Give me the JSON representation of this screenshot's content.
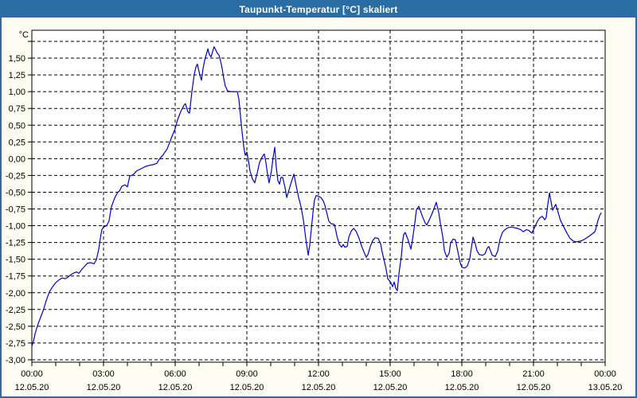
{
  "window": {
    "title": "Taupunkt-Temperatur [°C] skaliert",
    "title_bar_color": "#2a6da4",
    "frame_color": "#2a6da4",
    "background_color": "#fcfcf0",
    "plot_background_color": "#ffffff"
  },
  "chart_data": {
    "type": "line",
    "title": "Taupunkt-Temperatur [°C] skaliert",
    "xlabel": "",
    "ylabel": "°C",
    "ylim": [
      -3.05,
      1.92
    ],
    "xlim_hours": [
      0,
      24
    ],
    "grid": "dashed-black",
    "legend": "none",
    "line_color": "#0000cc",
    "axis_color": "#000000",
    "text_color": "#000000",
    "y_axis": {
      "unit": "°C",
      "gridline_step": 0.25,
      "top_gridline_value": 1.75,
      "bottom_gridline_value": -3.0,
      "ticks": [
        {
          "value": 1.5,
          "label": "1,50"
        },
        {
          "value": 1.25,
          "label": "1,25"
        },
        {
          "value": 1.0,
          "label": "1,00"
        },
        {
          "value": 0.75,
          "label": "0,75"
        },
        {
          "value": 0.5,
          "label": "0,50"
        },
        {
          "value": 0.25,
          "label": "0,25"
        },
        {
          "value": 0.0,
          "label": "0,00"
        },
        {
          "value": -0.25,
          "label": "-0,25"
        },
        {
          "value": -0.5,
          "label": "-0,50"
        },
        {
          "value": -0.75,
          "label": "-0,75"
        },
        {
          "value": -1.0,
          "label": "-1,00"
        },
        {
          "value": -1.25,
          "label": "-1,25"
        },
        {
          "value": -1.5,
          "label": "-1,50"
        },
        {
          "value": -1.75,
          "label": "-1,75"
        },
        {
          "value": -2.0,
          "label": "-2,00"
        },
        {
          "value": -2.25,
          "label": "-2,25"
        },
        {
          "value": -2.5,
          "label": "-2,50"
        },
        {
          "value": -2.75,
          "label": "-2,75"
        },
        {
          "value": -3.0,
          "label": "-3,00"
        }
      ]
    },
    "x_axis": {
      "minor_tick_every_hours": 1,
      "major_ticks": [
        {
          "hour": 0,
          "time": "00:00",
          "date": "12.05.20"
        },
        {
          "hour": 3,
          "time": "03:00",
          "date": "12.05.20"
        },
        {
          "hour": 6,
          "time": "06:00",
          "date": "12.05.20"
        },
        {
          "hour": 9,
          "time": "09:00",
          "date": "12.05.20"
        },
        {
          "hour": 12,
          "time": "12:00",
          "date": "12.05.20"
        },
        {
          "hour": 15,
          "time": "15:00",
          "date": "12.05.20"
        },
        {
          "hour": 18,
          "time": "18:00",
          "date": "12.05.20"
        },
        {
          "hour": 21,
          "time": "21:00",
          "date": "12.05.20"
        },
        {
          "hour": 24,
          "time": "00:00",
          "date": "13.05.20"
        }
      ]
    },
    "series": [
      {
        "name": "Taupunkt-Temperatur",
        "points": [
          [
            0,
            -2.8
          ],
          [
            0.07,
            -2.72
          ],
          [
            0.13,
            -2.62
          ],
          [
            0.2,
            -2.53
          ],
          [
            0.33,
            -2.4
          ],
          [
            0.47,
            -2.27
          ],
          [
            0.6,
            -2.12
          ],
          [
            0.73,
            -1.99
          ],
          [
            0.87,
            -1.91
          ],
          [
            1,
            -1.85
          ],
          [
            1.13,
            -1.81
          ],
          [
            1.27,
            -1.78
          ],
          [
            1.4,
            -1.79
          ],
          [
            1.5,
            -1.77
          ],
          [
            1.6,
            -1.74
          ],
          [
            1.73,
            -1.71
          ],
          [
            1.87,
            -1.69
          ],
          [
            1.97,
            -1.71
          ],
          [
            2.07,
            -1.66
          ],
          [
            2.2,
            -1.61
          ],
          [
            2.33,
            -1.56
          ],
          [
            2.47,
            -1.55
          ],
          [
            2.6,
            -1.57
          ],
          [
            2.7,
            -1.51
          ],
          [
            2.8,
            -1.35
          ],
          [
            2.87,
            -1.18
          ],
          [
            2.93,
            -1.06
          ],
          [
            3,
            -1.02
          ],
          [
            3.13,
            -1
          ],
          [
            3.23,
            -0.93
          ],
          [
            3.33,
            -0.72
          ],
          [
            3.43,
            -0.62
          ],
          [
            3.5,
            -0.56
          ],
          [
            3.6,
            -0.5
          ],
          [
            3.67,
            -0.48
          ],
          [
            3.77,
            -0.41
          ],
          [
            3.9,
            -0.39
          ],
          [
            4,
            -0.42
          ],
          [
            4.1,
            -0.26
          ],
          [
            4.23,
            -0.24
          ],
          [
            4.4,
            -0.18
          ],
          [
            4.57,
            -0.15
          ],
          [
            4.73,
            -0.12
          ],
          [
            4.9,
            -0.1
          ],
          [
            5.07,
            -0.09
          ],
          [
            5.23,
            -0.07
          ],
          [
            5.33,
            -0.01
          ],
          [
            5.5,
            0.06
          ],
          [
            5.67,
            0.15
          ],
          [
            5.83,
            0.3
          ],
          [
            6,
            0.45
          ],
          [
            6.1,
            0.58
          ],
          [
            6.23,
            0.7
          ],
          [
            6.37,
            0.8
          ],
          [
            6.43,
            0.82
          ],
          [
            6.53,
            0.7
          ],
          [
            6.6,
            0.68
          ],
          [
            6.7,
            1
          ],
          [
            6.8,
            1.26
          ],
          [
            6.87,
            1.37
          ],
          [
            6.93,
            1.41
          ],
          [
            7.03,
            1.25
          ],
          [
            7.1,
            1.17
          ],
          [
            7.17,
            1.35
          ],
          [
            7.23,
            1.46
          ],
          [
            7.3,
            1.55
          ],
          [
            7.37,
            1.64
          ],
          [
            7.43,
            1.55
          ],
          [
            7.5,
            1.52
          ],
          [
            7.57,
            1.6
          ],
          [
            7.63,
            1.67
          ],
          [
            7.7,
            1.62
          ],
          [
            7.77,
            1.57
          ],
          [
            7.83,
            1.55
          ],
          [
            7.9,
            1.46
          ],
          [
            7.97,
            1.34
          ],
          [
            8.03,
            1.2
          ],
          [
            8.1,
            1.08
          ],
          [
            8.2,
            1.01
          ],
          [
            8.33,
            1
          ],
          [
            8.6,
            1
          ],
          [
            8.67,
            0.88
          ],
          [
            8.73,
            0.65
          ],
          [
            8.8,
            0.4
          ],
          [
            8.87,
            0.18
          ],
          [
            8.93,
            0.05
          ],
          [
            9,
            0.1
          ],
          [
            9.07,
            -0.03
          ],
          [
            9.13,
            -0.18
          ],
          [
            9.23,
            -0.3
          ],
          [
            9.33,
            -0.36
          ],
          [
            9.43,
            -0.22
          ],
          [
            9.53,
            -0.06
          ],
          [
            9.63,
            0.02
          ],
          [
            9.73,
            0.07
          ],
          [
            9.8,
            -0.06
          ],
          [
            9.87,
            -0.24
          ],
          [
            9.93,
            -0.36
          ],
          [
            10.03,
            -0.18
          ],
          [
            10.1,
            0.02
          ],
          [
            10.17,
            0.17
          ],
          [
            10.23,
            -0.12
          ],
          [
            10.3,
            -0.33
          ],
          [
            10.37,
            -0.38
          ],
          [
            10.43,
            -0.28
          ],
          [
            10.5,
            -0.28
          ],
          [
            10.6,
            -0.43
          ],
          [
            10.67,
            -0.58
          ],
          [
            10.77,
            -0.46
          ],
          [
            10.87,
            -0.34
          ],
          [
            10.97,
            -0.23
          ],
          [
            11.07,
            -0.41
          ],
          [
            11.17,
            -0.58
          ],
          [
            11.27,
            -0.72
          ],
          [
            11.37,
            -0.92
          ],
          [
            11.47,
            -1.2
          ],
          [
            11.57,
            -1.44
          ],
          [
            11.63,
            -1.3
          ],
          [
            11.7,
            -1.05
          ],
          [
            11.77,
            -0.8
          ],
          [
            11.83,
            -0.62
          ],
          [
            11.9,
            -0.55
          ],
          [
            12,
            -0.56
          ],
          [
            12.1,
            -0.58
          ],
          [
            12.2,
            -0.63
          ],
          [
            12.27,
            -0.7
          ],
          [
            12.37,
            -0.84
          ],
          [
            12.43,
            -0.93
          ],
          [
            12.53,
            -0.97
          ],
          [
            12.67,
            -0.98
          ],
          [
            12.77,
            -1.15
          ],
          [
            12.87,
            -1.28
          ],
          [
            12.97,
            -1.32
          ],
          [
            13.03,
            -1.28
          ],
          [
            13.1,
            -1.32
          ],
          [
            13.2,
            -1.31
          ],
          [
            13.27,
            -1.17
          ],
          [
            13.37,
            -1.08
          ],
          [
            13.47,
            -1.04
          ],
          [
            13.57,
            -1.08
          ],
          [
            13.7,
            -1.19
          ],
          [
            13.8,
            -1.3
          ],
          [
            13.9,
            -1.39
          ],
          [
            14,
            -1.47
          ],
          [
            14.07,
            -1.43
          ],
          [
            14.17,
            -1.31
          ],
          [
            14.27,
            -1.22
          ],
          [
            14.37,
            -1.18
          ],
          [
            14.5,
            -1.19
          ],
          [
            14.6,
            -1.27
          ],
          [
            14.67,
            -1.4
          ],
          [
            14.77,
            -1.55
          ],
          [
            14.83,
            -1.65
          ],
          [
            14.9,
            -1.79
          ],
          [
            15.03,
            -1.85
          ],
          [
            15.1,
            -1.91
          ],
          [
            15.17,
            -1.84
          ],
          [
            15.23,
            -1.93
          ],
          [
            15.3,
            -1.97
          ],
          [
            15.37,
            -1.71
          ],
          [
            15.47,
            -1.45
          ],
          [
            15.53,
            -1.21
          ],
          [
            15.57,
            -1.13
          ],
          [
            15.63,
            -1.1
          ],
          [
            15.73,
            -1.19
          ],
          [
            15.87,
            -1.35
          ],
          [
            15.93,
            -1.22
          ],
          [
            16.03,
            -0.97
          ],
          [
            16.1,
            -0.76
          ],
          [
            16.2,
            -0.71
          ],
          [
            16.27,
            -0.78
          ],
          [
            16.37,
            -0.88
          ],
          [
            16.47,
            -0.96
          ],
          [
            16.53,
            -0.99
          ],
          [
            16.63,
            -0.92
          ],
          [
            16.73,
            -0.84
          ],
          [
            16.83,
            -0.75
          ],
          [
            16.93,
            -0.65
          ],
          [
            17.03,
            -0.8
          ],
          [
            17.1,
            -0.96
          ],
          [
            17.2,
            -1.16
          ],
          [
            17.27,
            -1.37
          ],
          [
            17.37,
            -1.47
          ],
          [
            17.47,
            -1.41
          ],
          [
            17.53,
            -1.26
          ],
          [
            17.63,
            -1.2
          ],
          [
            17.73,
            -1.21
          ],
          [
            17.83,
            -1.38
          ],
          [
            17.93,
            -1.55
          ],
          [
            18,
            -1.62
          ],
          [
            18.13,
            -1.63
          ],
          [
            18.23,
            -1.6
          ],
          [
            18.33,
            -1.5
          ],
          [
            18.4,
            -1.33
          ],
          [
            18.47,
            -1.17
          ],
          [
            18.57,
            -1.28
          ],
          [
            18.63,
            -1.37
          ],
          [
            18.73,
            -1.43
          ],
          [
            18.87,
            -1.44
          ],
          [
            18.97,
            -1.42
          ],
          [
            19.07,
            -1.33
          ],
          [
            19.13,
            -1.31
          ],
          [
            19.27,
            -1.44
          ],
          [
            19.4,
            -1.46
          ],
          [
            19.5,
            -1.38
          ],
          [
            19.6,
            -1.2
          ],
          [
            19.7,
            -1.1
          ],
          [
            19.8,
            -1.06
          ],
          [
            19.93,
            -1.03
          ],
          [
            20.07,
            -1.02
          ],
          [
            20.2,
            -1.03
          ],
          [
            20.33,
            -1.04
          ],
          [
            20.47,
            -1.06
          ],
          [
            20.57,
            -1.09
          ],
          [
            20.7,
            -1.06
          ],
          [
            20.8,
            -1.07
          ],
          [
            20.93,
            -1.11
          ],
          [
            21.03,
            -1.04
          ],
          [
            21.17,
            -0.93
          ],
          [
            21.27,
            -0.88
          ],
          [
            21.37,
            -0.86
          ],
          [
            21.47,
            -0.91
          ],
          [
            21.53,
            -0.88
          ],
          [
            21.6,
            -0.68
          ],
          [
            21.67,
            -0.51
          ],
          [
            21.73,
            -0.63
          ],
          [
            21.8,
            -0.77
          ],
          [
            21.87,
            -0.72
          ],
          [
            21.93,
            -0.68
          ],
          [
            22.03,
            -0.8
          ],
          [
            22.13,
            -0.92
          ],
          [
            22.27,
            -1.02
          ],
          [
            22.4,
            -1.11
          ],
          [
            22.53,
            -1.19
          ],
          [
            22.67,
            -1.23
          ],
          [
            22.8,
            -1.24
          ],
          [
            22.97,
            -1.23
          ],
          [
            23.1,
            -1.21
          ],
          [
            23.27,
            -1.17
          ],
          [
            23.43,
            -1.13
          ],
          [
            23.57,
            -1.09
          ],
          [
            23.63,
            -1.02
          ],
          [
            23.7,
            -0.92
          ],
          [
            23.77,
            -0.85
          ],
          [
            23.83,
            -0.81
          ]
        ]
      }
    ]
  }
}
